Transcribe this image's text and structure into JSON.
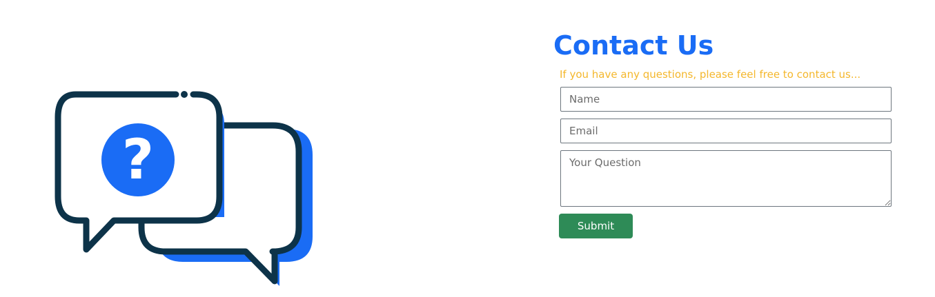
{
  "colors": {
    "title": "#1a6cf5",
    "subtitle": "#f4b72c",
    "submit_bg": "#2e8b57",
    "icon_dark": "#0d3349",
    "icon_accent": "#1a6cf5"
  },
  "illustration": {
    "icon": "chat-question-bubbles-icon"
  },
  "contact": {
    "title": "Contact Us",
    "subtitle": "If you have any questions, please feel free to contact us...",
    "form": {
      "name_placeholder": "Name",
      "email_placeholder": "Email",
      "question_placeholder": "Your Question",
      "submit_label": "Submit"
    }
  }
}
